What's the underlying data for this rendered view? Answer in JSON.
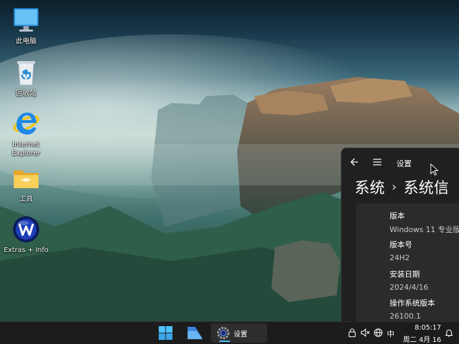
{
  "desktop": {
    "icons": [
      {
        "label": "此电脑"
      },
      {
        "label": "回收站"
      },
      {
        "label": "Internet Explorer"
      },
      {
        "label": "工具"
      },
      {
        "label": "Extras + Info"
      }
    ]
  },
  "settings_window": {
    "title": "设置",
    "breadcrumb": [
      "系统",
      "系统信"
    ],
    "rows": [
      {
        "key": "版本",
        "value": "Windows 11 专业版"
      },
      {
        "key": "版本号",
        "value": "24H2"
      },
      {
        "key": "安装日期",
        "value": "2024/4/16"
      },
      {
        "key": "操作系统版本",
        "value": "26100.1"
      }
    ]
  },
  "taskbar": {
    "settings_label": "设置",
    "ime": "中",
    "time": "8:05:17",
    "date": "周二 4月 16"
  },
  "colors": {
    "accent": "#4cc2ff",
    "window_bg": "#202020",
    "card_bg": "#2b2b2b",
    "taskbar_bg": "#1c1c1c"
  }
}
